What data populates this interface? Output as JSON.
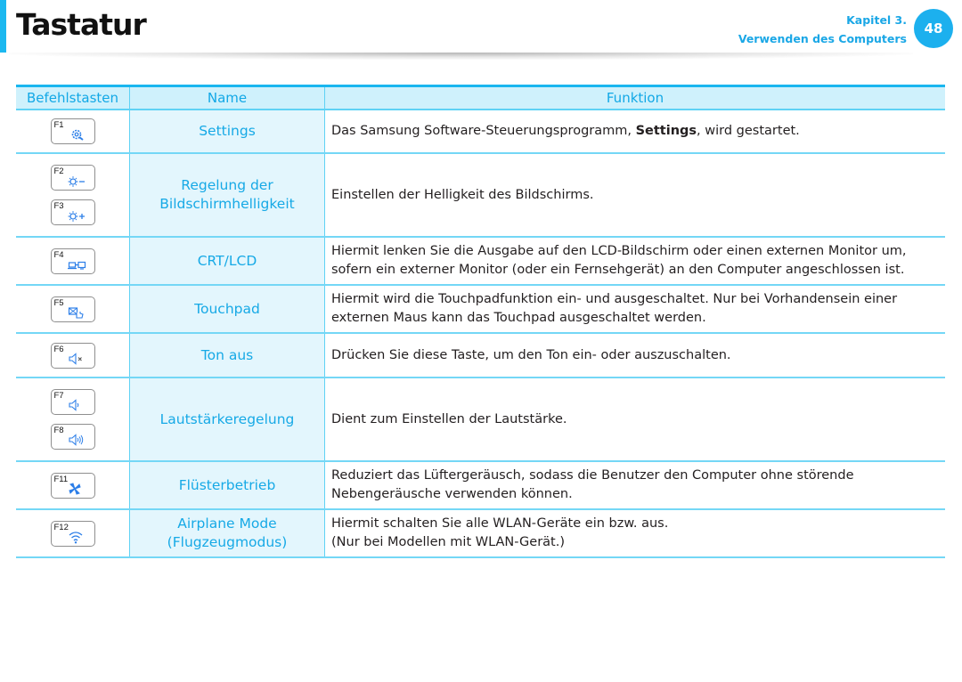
{
  "header": {
    "title": "Tastatur",
    "chapter_line1": "Kapitel 3.",
    "chapter_line2": "Verwenden des Computers",
    "page_number": "48"
  },
  "colors": {
    "accent": "#1cb8f0",
    "name_column_bg": "#e3f6fd",
    "header_bg": "#cff1fc",
    "icon_blue": "#2d7fe8"
  },
  "table": {
    "headers": [
      "Befehlstasten",
      "Name",
      "Funktion"
    ],
    "rows": [
      {
        "keys": [
          {
            "label": "F1",
            "icon": "settings-gear-icon"
          }
        ],
        "name": [
          "Settings"
        ],
        "function_pre": "Das Samsung Software-Steuerungsprogramm, ",
        "function_bold": "Settings",
        "function_post": ", wird gestartet."
      },
      {
        "keys": [
          {
            "label": "F2",
            "icon": "brightness-down-icon"
          },
          {
            "label": "F3",
            "icon": "brightness-up-icon"
          }
        ],
        "name": [
          "Regelung der",
          "Bildschirmhelligkeit"
        ],
        "function": [
          "Einstellen der Helligkeit des Bildschirms."
        ]
      },
      {
        "keys": [
          {
            "label": "F4",
            "icon": "display-switch-icon"
          }
        ],
        "name": [
          "CRT/LCD"
        ],
        "function": [
          "Hiermit lenken Sie die Ausgabe auf den LCD-Bildschirm oder einen externen Monitor um,",
          "sofern ein externer Monitor (oder ein Fernsehgerät) an den Computer angeschlossen ist."
        ]
      },
      {
        "keys": [
          {
            "label": "F5",
            "icon": "touchpad-toggle-icon"
          }
        ],
        "name": [
          "Touchpad"
        ],
        "function": [
          "Hiermit wird die Touchpadfunktion ein- und ausgeschaltet. Nur bei Vorhandensein einer",
          "externen Maus kann das Touchpad ausgeschaltet werden."
        ]
      },
      {
        "keys": [
          {
            "label": "F6",
            "icon": "mute-icon"
          }
        ],
        "name": [
          "Ton aus"
        ],
        "function": [
          "Drücken Sie diese Taste, um den Ton ein- oder auszuschalten."
        ]
      },
      {
        "keys": [
          {
            "label": "F7",
            "icon": "volume-down-icon"
          },
          {
            "label": "F8",
            "icon": "volume-up-icon"
          }
        ],
        "name": [
          "Lautstärkeregelung"
        ],
        "function": [
          "Dient zum Einstellen der Lautstärke."
        ]
      },
      {
        "keys": [
          {
            "label": "F11",
            "icon": "fan-icon"
          }
        ],
        "name": [
          "Flüsterbetrieb"
        ],
        "function": [
          "Reduziert das Lüftergeräusch, sodass die Benutzer den Computer ohne störende",
          "Nebengeräusche verwenden können."
        ]
      },
      {
        "keys": [
          {
            "label": "F12",
            "icon": "wifi-icon"
          }
        ],
        "name": [
          "Airplane Mode",
          "(Flugzeugmodus)"
        ],
        "function": [
          "Hiermit schalten Sie alle WLAN-Geräte ein bzw. aus.",
          "(Nur bei Modellen mit WLAN-Gerät.)"
        ]
      }
    ]
  }
}
